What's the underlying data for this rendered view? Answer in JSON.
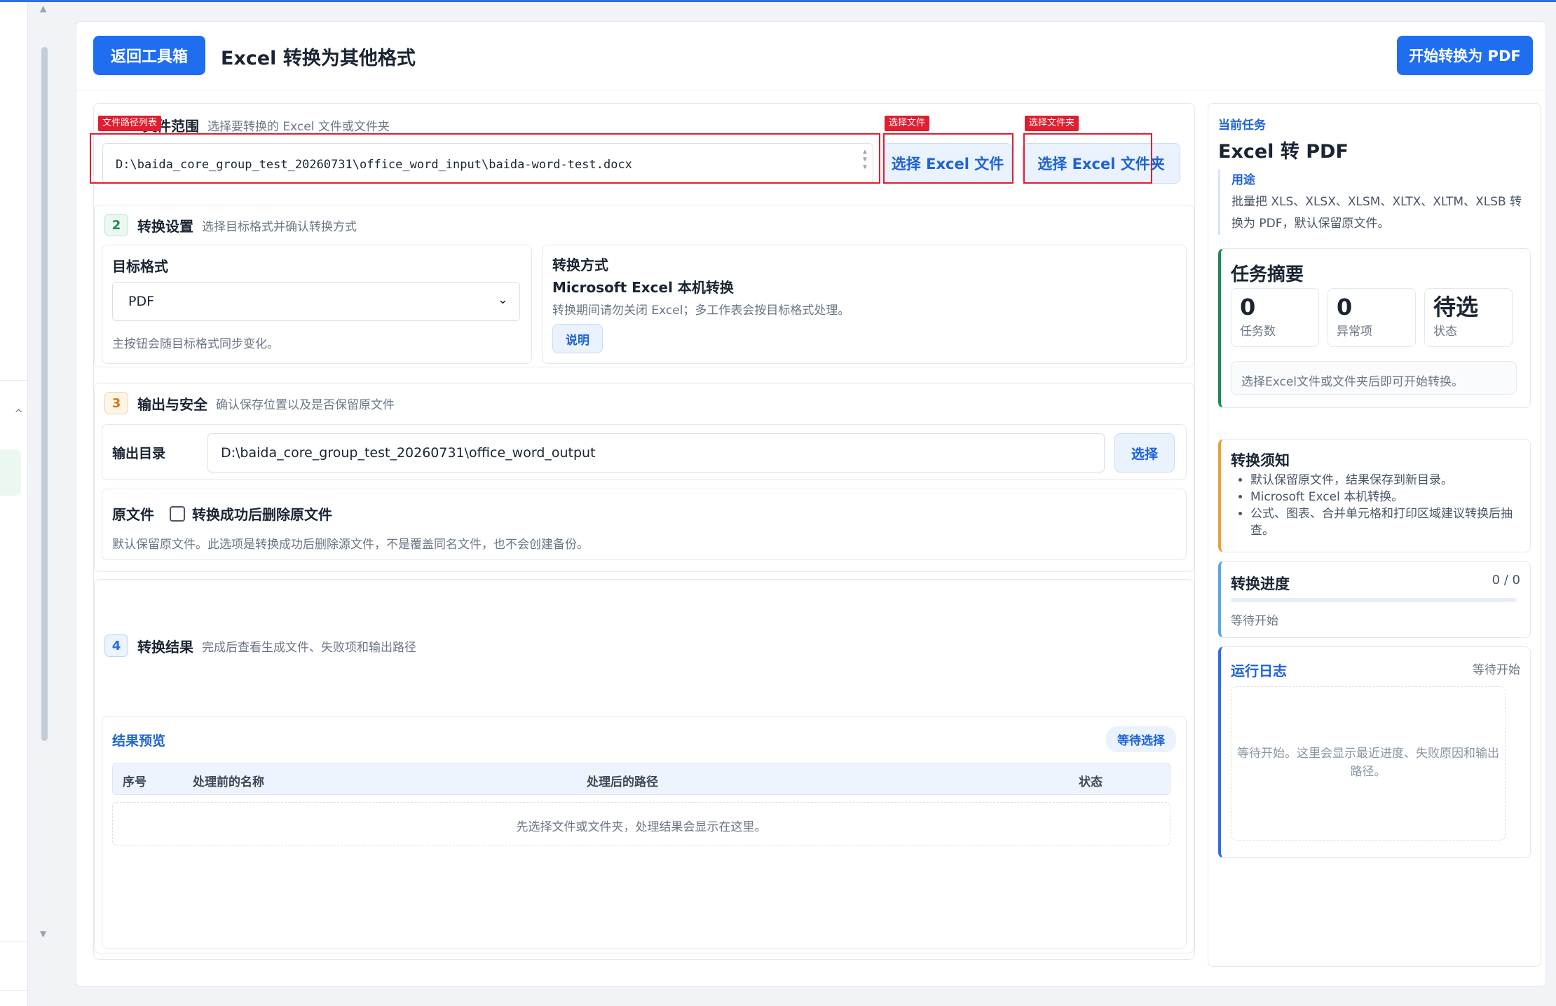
{
  "header": {
    "back_label": "返回工具箱",
    "title": "Excel 转换为其他格式",
    "start_label": "开始转换为 PDF"
  },
  "section1": {
    "title": "文件范围",
    "subtitle": "选择要转换的 Excel 文件或文件夹",
    "path": "D:\\baida_core_group_test_20260731\\office_word_input\\baida-word-test.docx",
    "pick_file_label": "选择 Excel 文件",
    "pick_folder_label": "选择 Excel 文件夹",
    "tag_path_list": "文件路径列表",
    "tag_pick_file": "选择文件",
    "tag_pick_folder": "选择文件夹"
  },
  "section2": {
    "number": "2",
    "title": "转换设置",
    "subtitle": "选择目标格式并确认转换方式",
    "target_label": "目标格式",
    "target_value": "PDF",
    "target_hint": "主按钮会随目标格式同步变化。",
    "method_label": "转换方式",
    "method_value": "Microsoft Excel 本机转换",
    "method_hint": "转换期间请勿关闭 Excel；多工作表会按目标格式处理。",
    "explain_label": "说明"
  },
  "section3": {
    "number": "3",
    "title": "输出与安全",
    "subtitle": "确认保存位置以及是否保留原文件",
    "output_label": "输出目录",
    "output_value": "D:\\baida_core_group_test_20260731\\office_word_output",
    "choose_label": "选择",
    "orig_label": "原文件",
    "delete_label": "转换成功后删除原文件",
    "delete_hint": "默认保留原文件。此选项是转换成功后删除源文件，不是覆盖同名文件，也不会创建备份。"
  },
  "section4": {
    "number": "4",
    "title": "转换结果",
    "subtitle": "完成后查看生成文件、失败项和输出路径",
    "preview_label": "结果预览",
    "status_pill": "等待选择",
    "columns": [
      "序号",
      "处理前的名称",
      "处理后的路径",
      "状态"
    ],
    "empty_text": "先选择文件或文件夹，处理结果会显示在这里。"
  },
  "side": {
    "current_task_label": "当前任务",
    "task_title": "Excel 转 PDF",
    "usage_label": "用途",
    "usage_text": "批量把 XLS、XLSX、XLSM、XLTX、XLTM、XLSB 转换为 PDF，默认保留原文件。",
    "summary_title": "任务摘要",
    "stats": [
      {
        "value": "0",
        "label": "任务数"
      },
      {
        "value": "0",
        "label": "异常项"
      },
      {
        "value": "待选",
        "label": "状态"
      }
    ],
    "summary_hint": "选择Excel文件或文件夹后即可开始转换。",
    "notes_title": "转换须知",
    "notes": [
      "默认保留原文件，结果保存到新目录。",
      "Microsoft Excel 本机转换。",
      "公式、图表、合并单元格和打印区域建议转换后抽查。"
    ],
    "progress_title": "转换进度",
    "progress_count": "0 / 0",
    "progress_value": 0,
    "progress_status": "等待开始",
    "log_title": "运行日志",
    "log_status": "等待开始",
    "log_placeholder": "等待开始。这里会显示最近进度、失败原因和输出路径。"
  },
  "colors": {
    "primary": "#1f6ef0",
    "annotation_red": "#e11d2f",
    "accent_green": "#1d8c54",
    "accent_orange": "#e8a23a",
    "accent_blue": "#1e63d4"
  }
}
